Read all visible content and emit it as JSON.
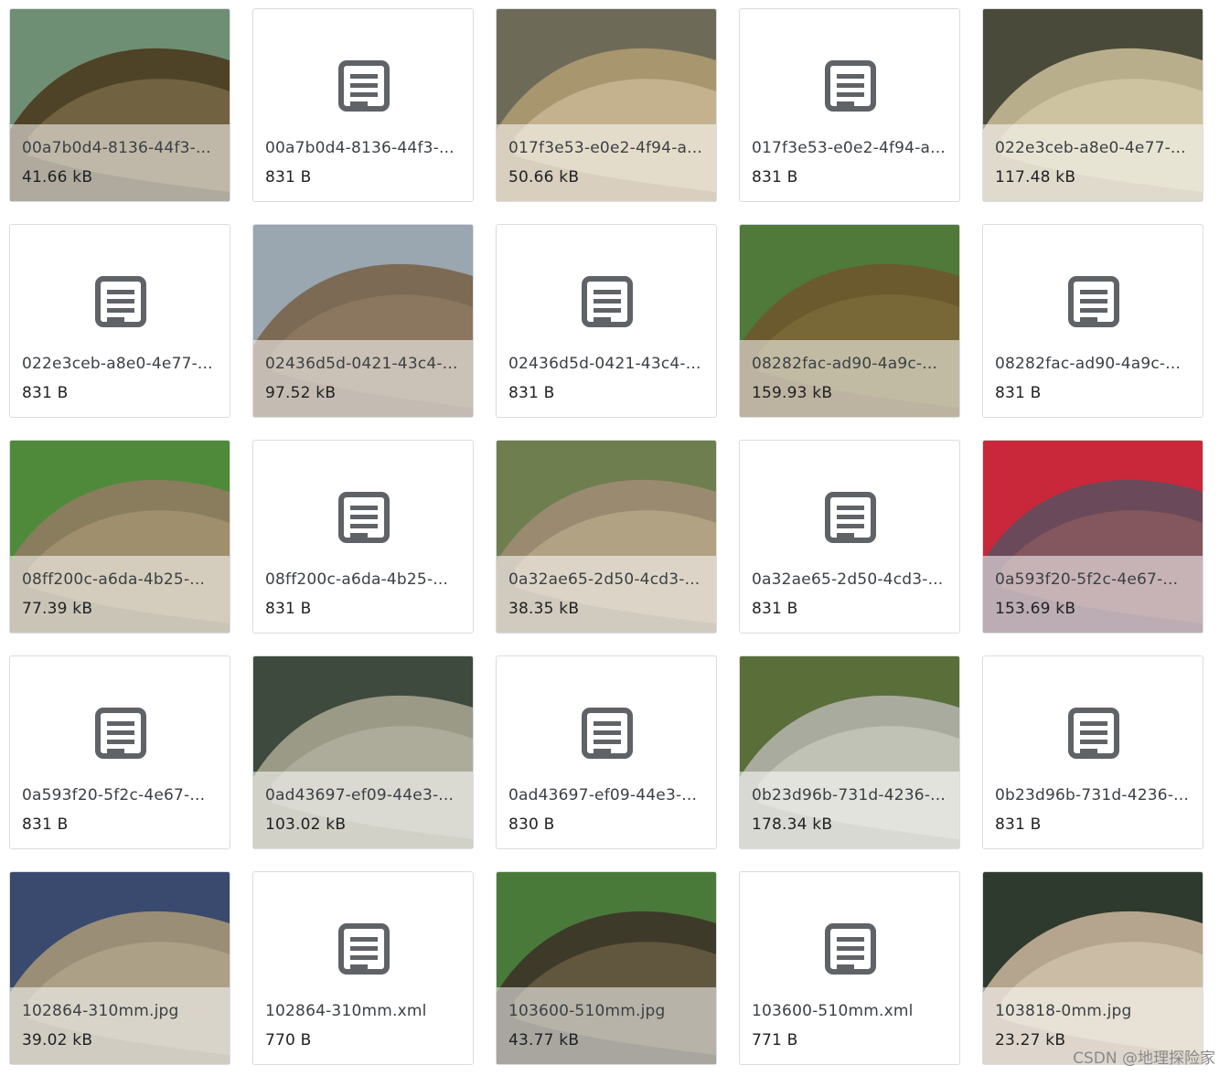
{
  "files": [
    {
      "name": "00a7b0d4-8136-44f3-...",
      "size": "41.66 kB",
      "kind": "image",
      "palette": [
        "#6f8f74",
        "#4e4326",
        "#7a6a48"
      ]
    },
    {
      "name": "00a7b0d4-8136-44f3-...",
      "size": "831 B",
      "kind": "doc"
    },
    {
      "name": "017f3e53-e0e2-4f94-a...",
      "size": "50.66 kB",
      "kind": "image",
      "palette": [
        "#6d6a58",
        "#a8966f",
        "#c9b995"
      ]
    },
    {
      "name": "017f3e53-e0e2-4f94-a...",
      "size": "831 B",
      "kind": "doc"
    },
    {
      "name": "022e3ceb-a8e0-4e77-...",
      "size": "117.48 kB",
      "kind": "image",
      "palette": [
        "#4a4a3a",
        "#b9ae8c",
        "#d2c8a6"
      ]
    },
    {
      "name": "022e3ceb-a8e0-4e77-...",
      "size": "831 B",
      "kind": "doc"
    },
    {
      "name": "02436d5d-0421-43c4-...",
      "size": "97.52 kB",
      "kind": "image",
      "palette": [
        "#9aa6b0",
        "#7d6a55",
        "#8f7b62"
      ]
    },
    {
      "name": "02436d5d-0421-43c4-...",
      "size": "831 B",
      "kind": "doc"
    },
    {
      "name": "08282fac-ad90-4a9c-...",
      "size": "159.93 kB",
      "kind": "image",
      "palette": [
        "#4f7a3a",
        "#6b5a2e",
        "#7d6b3a"
      ]
    },
    {
      "name": "08282fac-ad90-4a9c-...",
      "size": "831 B",
      "kind": "doc"
    },
    {
      "name": "08ff200c-a6da-4b25-...",
      "size": "77.39 kB",
      "kind": "image",
      "palette": [
        "#4f8a3a",
        "#8a7d5e",
        "#a59470"
      ]
    },
    {
      "name": "08ff200c-a6da-4b25-...",
      "size": "831 B",
      "kind": "doc"
    },
    {
      "name": "0a32ae65-2d50-4cd3-...",
      "size": "38.35 kB",
      "kind": "image",
      "palette": [
        "#6e7e4e",
        "#9a8a70",
        "#b8a88a"
      ]
    },
    {
      "name": "0a32ae65-2d50-4cd3-...",
      "size": "831 B",
      "kind": "doc"
    },
    {
      "name": "0a593f20-5f2c-4e67-...",
      "size": "153.69 kB",
      "kind": "image",
      "palette": [
        "#c9283a",
        "#6a4a5a",
        "#8a5a5e"
      ]
    },
    {
      "name": "0a593f20-5f2c-4e67-...",
      "size": "831 B",
      "kind": "doc"
    },
    {
      "name": "0ad43697-ef09-44e3-...",
      "size": "103.02 kB",
      "kind": "image",
      "palette": [
        "#3e4a3e",
        "#9a9a86",
        "#b2b0a0"
      ]
    },
    {
      "name": "0ad43697-ef09-44e3-...",
      "size": "830 B",
      "kind": "doc"
    },
    {
      "name": "0b23d96b-731d-4236-...",
      "size": "178.34 kB",
      "kind": "image",
      "palette": [
        "#5a6e3a",
        "#a9ab9e",
        "#c6c8bc"
      ]
    },
    {
      "name": "0b23d96b-731d-4236-...",
      "size": "831 B",
      "kind": "doc"
    },
    {
      "name": "102864-310mm.jpg",
      "size": "39.02 kB",
      "kind": "image",
      "palette": [
        "#3a4a6e",
        "#9a8e76",
        "#b0a58c"
      ]
    },
    {
      "name": "102864-310mm.xml",
      "size": "770 B",
      "kind": "doc"
    },
    {
      "name": "103600-510mm.jpg",
      "size": "43.77 kB",
      "kind": "image",
      "palette": [
        "#4a7a3a",
        "#3e3a2a",
        "#6a5f44"
      ]
    },
    {
      "name": "103600-510mm.xml",
      "size": "771 B",
      "kind": "doc"
    },
    {
      "name": "103818-0mm.jpg",
      "size": "23.27 kB",
      "kind": "image",
      "palette": [
        "#2e3a2e",
        "#b5a58e",
        "#cfc2ab"
      ]
    }
  ],
  "watermark": "CSDN @地理探险家",
  "colors": {
    "icon": "#5f6368",
    "border": "#dadce0"
  }
}
